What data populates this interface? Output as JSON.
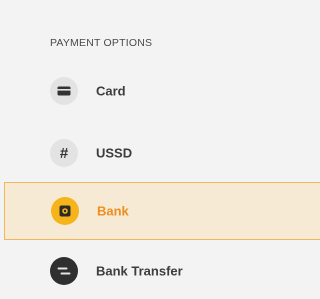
{
  "payment": {
    "section_title": "PAYMENT OPTIONS",
    "options": [
      {
        "label": "Card",
        "icon": "card-icon",
        "selected": false
      },
      {
        "label": "USSD",
        "icon": "hash-icon",
        "selected": false
      },
      {
        "label": "Bank",
        "icon": "bank-icon",
        "selected": true
      },
      {
        "label": "Bank Transfer",
        "icon": "transfer-icon",
        "selected": false
      }
    ]
  },
  "colors": {
    "background": "#f3f3f3",
    "selected_background": "#f6ead5",
    "selected_border": "#f2b75c",
    "accent": "#f6b41b",
    "selected_text": "#ef8e1c",
    "icon_circle": "#e3e3e3"
  }
}
